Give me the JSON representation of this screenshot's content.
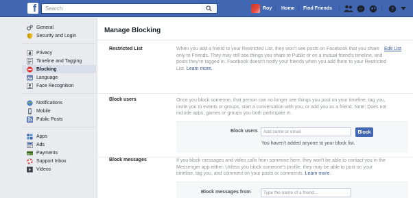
{
  "header": {
    "logo": "f",
    "search_placeholder": "Search",
    "profile_name": "Roy",
    "home": "Home",
    "find_friends": "Find Friends"
  },
  "sidebar": {
    "groups": [
      [
        {
          "label": "General",
          "icon": "gear-icon"
        },
        {
          "label": "Security and Login",
          "icon": "shield-icon"
        }
      ],
      [
        {
          "label": "Privacy",
          "icon": "lock-icon"
        },
        {
          "label": "Timeline and Tagging",
          "icon": "timeline-icon"
        },
        {
          "label": "Blocking",
          "icon": "block-icon",
          "active": true
        },
        {
          "label": "Language",
          "icon": "language-icon"
        },
        {
          "label": "Face Recognition",
          "icon": "face-icon"
        }
      ],
      [
        {
          "label": "Notifications",
          "icon": "globe-icon"
        },
        {
          "label": "Mobile",
          "icon": "mobile-icon"
        },
        {
          "label": "Public Posts",
          "icon": "rss-icon"
        }
      ],
      [
        {
          "label": "Apps",
          "icon": "apps-icon"
        },
        {
          "label": "Ads",
          "icon": "ads-icon"
        },
        {
          "label": "Payments",
          "icon": "payments-icon"
        },
        {
          "label": "Support Inbox",
          "icon": "lifebuoy-icon"
        },
        {
          "label": "Videos",
          "icon": "video-icon"
        }
      ]
    ]
  },
  "main": {
    "title": "Manage Blocking",
    "restricted": {
      "label": "Restricted List",
      "desc": "When you add a friend to your Restricted List, they won't see posts on Facebook that you share only to Friends. They may still see things you share to Public or on a mutual friend's timeline, and posts they're tagged in. Facebook doesn't notify your friends when you add them to your Restricted List.",
      "learn_more": "Learn more.",
      "edit": "Edit List"
    },
    "block_users": {
      "label": "Block users",
      "desc": "Once you block someone, that person can no longer see things you post on your timeline, tag you, invite you to events or groups, start a conversation with you, or add you as a friend. Note: Does not include apps, games or groups you both participate in.",
      "field_label": "Block users",
      "placeholder": "Add name or email",
      "button": "Block",
      "note": "You haven't added anyone to your block list."
    },
    "block_messages": {
      "label": "Block messages",
      "desc": "If you block messages and video calls from someone here, they won't be able to contact you in the Messenger app either. Unless you block someone's profile, they may be able to post on your timeline, tag you, and comment on your posts or comments.",
      "learn_more": "Learn more.",
      "field_label": "Block messages from",
      "placeholder": "Type the name of a friend..."
    }
  },
  "colors": {
    "brand": "#4267b2",
    "link": "#365899",
    "active_bg": "#d8dfea"
  }
}
